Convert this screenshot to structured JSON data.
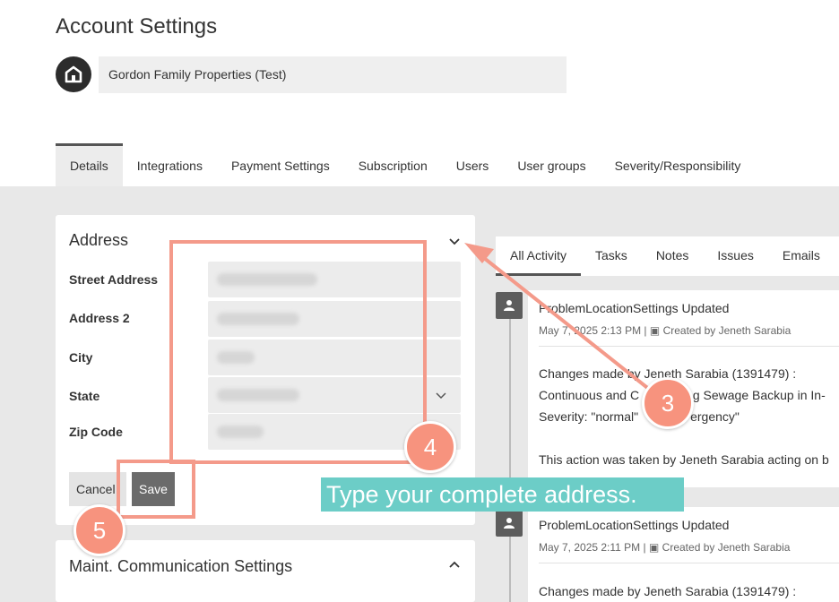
{
  "page": {
    "title": "Account Settings"
  },
  "account": {
    "name": "Gordon Family Properties (Test)"
  },
  "tabs": [
    {
      "label": "Details"
    },
    {
      "label": "Integrations"
    },
    {
      "label": "Payment Settings"
    },
    {
      "label": "Subscription"
    },
    {
      "label": "Users"
    },
    {
      "label": "User groups"
    },
    {
      "label": "Severity/Responsibility"
    }
  ],
  "address": {
    "title": "Address",
    "fields": {
      "street": {
        "label": "Street Address"
      },
      "address2": {
        "label": "Address 2"
      },
      "city": {
        "label": "City"
      },
      "state": {
        "label": "State"
      },
      "zip": {
        "label": "Zip Code"
      }
    },
    "cancel_label": "Cancel",
    "save_label": "Save"
  },
  "maint": {
    "title": "Maint. Communication Settings"
  },
  "activity": {
    "tabs": [
      {
        "label": "All Activity"
      },
      {
        "label": "Tasks"
      },
      {
        "label": "Notes"
      },
      {
        "label": "Issues"
      },
      {
        "label": "Emails"
      }
    ],
    "entries": [
      {
        "title": "ProblemLocationSettings Updated",
        "date": "May 7, 2025 2:13 PM",
        "created_by": "Created by Jeneth Sarabia",
        "body_lines": [
          "Changes made by Jeneth Sarabia (1391479) :",
          "Continuous and C",
          "ng Sewage Backup in In-",
          "Severity: \"normal\"",
          "ergency\""
        ],
        "footer": "This action was taken by Jeneth Sarabia acting on b"
      },
      {
        "title": "ProblemLocationSettings Updated",
        "date": "May 7, 2025 2:11 PM",
        "created_by": "Created by Jeneth Sarabia",
        "body_lines": [
          "Changes made by Jeneth Sarabia (1391479) :"
        ]
      }
    ]
  },
  "annotations": {
    "step3": "3",
    "step4": "4",
    "step5": "5",
    "callout": "Type your complete address."
  },
  "colors": {
    "highlight": "#f49a8a",
    "step_circle": "#f7937e",
    "callout_bg": "#6ccdc7",
    "save_button": "#6b6b6b",
    "avatar": "#2c2c2c"
  },
  "icons": [
    "home-icon",
    "chevron-down-icon",
    "chevron-up-icon",
    "person-icon",
    "building-icon"
  ]
}
